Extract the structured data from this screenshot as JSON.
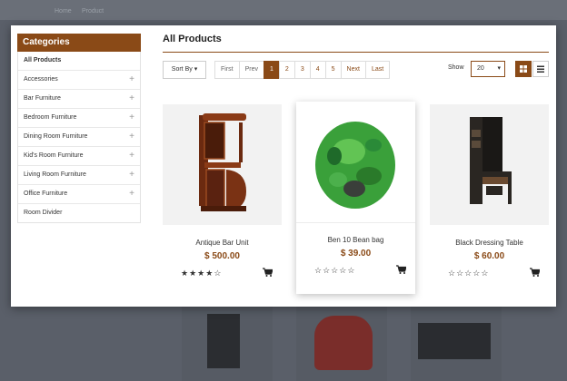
{
  "background": {
    "nav": [
      "Home",
      "Product"
    ]
  },
  "sidebar": {
    "title": "Categories",
    "items": [
      {
        "label": "All Products",
        "expandable": false,
        "active": true
      },
      {
        "label": "Accessories",
        "expandable": true
      },
      {
        "label": "Bar Furniture",
        "expandable": true
      },
      {
        "label": "Bedroom Furniture",
        "expandable": true
      },
      {
        "label": "Dining Room Furniture",
        "expandable": true
      },
      {
        "label": "Kid's Room Furniture",
        "expandable": true
      },
      {
        "label": "Living Room Furniture",
        "expandable": true
      },
      {
        "label": "Office Furniture",
        "expandable": true
      },
      {
        "label": "Room Divider",
        "expandable": false
      }
    ],
    "expand_icon": "plus-icon"
  },
  "main": {
    "title": "All Products"
  },
  "toolbar": {
    "sort_label": "Sort By",
    "pagination": [
      "First",
      "Prev",
      "1",
      "2",
      "3",
      "4",
      "5",
      "Next",
      "Last"
    ],
    "current_page": "1",
    "show_label": "Show",
    "show_value": "20",
    "grid_view_icon": "grid-view-icon",
    "list_view_icon": "list-view-icon"
  },
  "products": [
    {
      "name": "Antique Bar Unit",
      "price": "$ 500.00",
      "rating": 4,
      "rating_max": 5
    },
    {
      "name": "Ben 10 Bean bag",
      "price": "$ 39.00",
      "rating": 0,
      "rating_max": 5
    },
    {
      "name": "Black Dressing Table",
      "price": "$ 60.00",
      "rating": 0,
      "rating_max": 5
    }
  ],
  "colors": {
    "accent": "#8a4a17",
    "overlay": "#5a5f69"
  }
}
